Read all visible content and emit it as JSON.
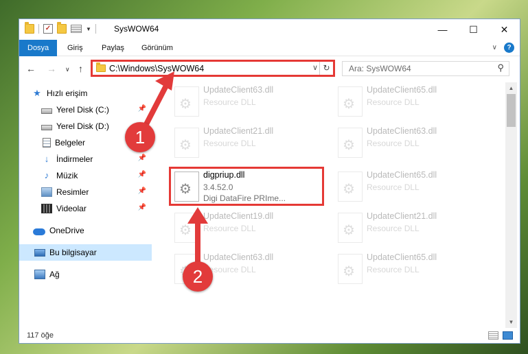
{
  "window": {
    "title": "SysWOW64",
    "buttons": {
      "minimize": "—",
      "maximize": "☐",
      "close": "✕"
    }
  },
  "ribbon": {
    "tabs": [
      {
        "label": "Dosya",
        "active": true
      },
      {
        "label": "Giriş"
      },
      {
        "label": "Paylaş"
      },
      {
        "label": "Görünüm"
      }
    ],
    "help": "?"
  },
  "navigation": {
    "address": "C:\\Windows\\SysWOW64",
    "search_placeholder": "Ara: SysWOW64"
  },
  "sidebar": {
    "items": [
      {
        "label": "Hızlı erişim",
        "icon": "star-icon"
      },
      {
        "label": "Yerel Disk (C:)",
        "icon": "disk-icon",
        "pinned": true
      },
      {
        "label": "Yerel Disk (D:)",
        "icon": "disk-icon"
      },
      {
        "label": "Belgeler",
        "icon": "documents-icon"
      },
      {
        "label": "İndirmeler",
        "icon": "download-icon",
        "pinned": true
      },
      {
        "label": "Müzik",
        "icon": "music-icon",
        "pinned": true
      },
      {
        "label": "Resimler",
        "icon": "pictures-icon",
        "pinned": true
      },
      {
        "label": "Videolar",
        "icon": "videos-icon",
        "pinned": true
      },
      {
        "label": "OneDrive",
        "icon": "onedrive-icon"
      },
      {
        "label": "Bu bilgisayar",
        "icon": "computer-icon",
        "selected": true
      },
      {
        "label": "Ağ",
        "icon": "network-icon"
      }
    ]
  },
  "files": {
    "left": [
      {
        "name": "UpdateClient63.dll",
        "line1": "Resource DLL"
      },
      {
        "name": "UpdateClient21.dll",
        "line1": "Resource DLL"
      },
      {
        "name": "digpriup.dll",
        "line1": "3.4.52.0",
        "line2": "Digi DataFire PRIme...",
        "highlighted": true
      },
      {
        "name": "UpdateClient19.dll",
        "line1": "Resource DLL"
      },
      {
        "name": "UpdateClient63.dll",
        "line1": "Resource DLL"
      }
    ],
    "right": [
      {
        "name": "UpdateClient65.dll",
        "line1": "Resource DLL"
      },
      {
        "name": "UpdateClient63.dll",
        "line1": "Resource DLL"
      },
      {
        "name": "UpdateClient65.dll",
        "line1": "Resource DLL"
      },
      {
        "name": "UpdateClient21.dll",
        "line1": "Resource DLL"
      },
      {
        "name": "UpdateClient65.dll",
        "line1": "Resource DLL"
      }
    ]
  },
  "status": {
    "item_count": "117 öğe"
  },
  "annotations": {
    "step1": "1",
    "step2": "2",
    "color": "#e23b3b"
  }
}
